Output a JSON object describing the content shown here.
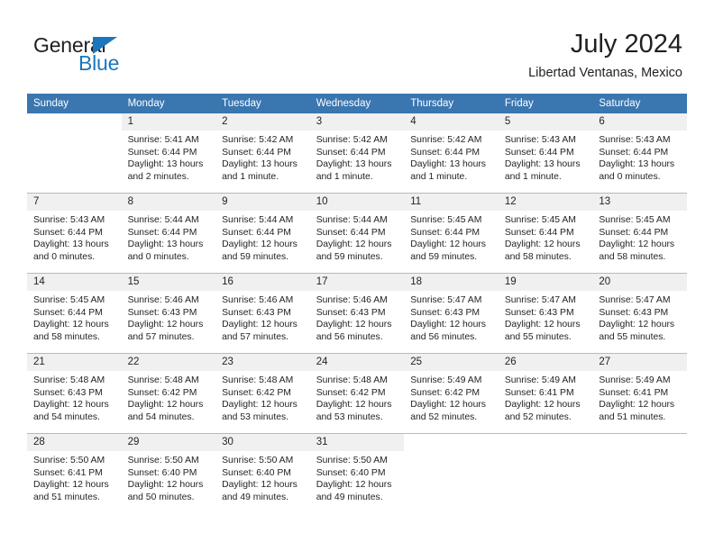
{
  "brand": {
    "name_part1": "General",
    "name_part2": "Blue",
    "triangle_color": "#1b76bc"
  },
  "header": {
    "title": "July 2024",
    "subtitle": "Libertad Ventanas, Mexico",
    "header_bg": "#3a76b0",
    "daynum_bg": "#f0f0f0"
  },
  "weekdays": [
    "Sunday",
    "Monday",
    "Tuesday",
    "Wednesday",
    "Thursday",
    "Friday",
    "Saturday"
  ],
  "weeks": [
    [
      {
        "day": "",
        "sunrise": "",
        "sunset": "",
        "daylight1": "",
        "daylight2": "",
        "empty": true
      },
      {
        "day": "1",
        "sunrise": "Sunrise: 5:41 AM",
        "sunset": "Sunset: 6:44 PM",
        "daylight1": "Daylight: 13 hours",
        "daylight2": "and 2 minutes."
      },
      {
        "day": "2",
        "sunrise": "Sunrise: 5:42 AM",
        "sunset": "Sunset: 6:44 PM",
        "daylight1": "Daylight: 13 hours",
        "daylight2": "and 1 minute."
      },
      {
        "day": "3",
        "sunrise": "Sunrise: 5:42 AM",
        "sunset": "Sunset: 6:44 PM",
        "daylight1": "Daylight: 13 hours",
        "daylight2": "and 1 minute."
      },
      {
        "day": "4",
        "sunrise": "Sunrise: 5:42 AM",
        "sunset": "Sunset: 6:44 PM",
        "daylight1": "Daylight: 13 hours",
        "daylight2": "and 1 minute."
      },
      {
        "day": "5",
        "sunrise": "Sunrise: 5:43 AM",
        "sunset": "Sunset: 6:44 PM",
        "daylight1": "Daylight: 13 hours",
        "daylight2": "and 1 minute."
      },
      {
        "day": "6",
        "sunrise": "Sunrise: 5:43 AM",
        "sunset": "Sunset: 6:44 PM",
        "daylight1": "Daylight: 13 hours",
        "daylight2": "and 0 minutes."
      }
    ],
    [
      {
        "day": "7",
        "sunrise": "Sunrise: 5:43 AM",
        "sunset": "Sunset: 6:44 PM",
        "daylight1": "Daylight: 13 hours",
        "daylight2": "and 0 minutes."
      },
      {
        "day": "8",
        "sunrise": "Sunrise: 5:44 AM",
        "sunset": "Sunset: 6:44 PM",
        "daylight1": "Daylight: 13 hours",
        "daylight2": "and 0 minutes."
      },
      {
        "day": "9",
        "sunrise": "Sunrise: 5:44 AM",
        "sunset": "Sunset: 6:44 PM",
        "daylight1": "Daylight: 12 hours",
        "daylight2": "and 59 minutes."
      },
      {
        "day": "10",
        "sunrise": "Sunrise: 5:44 AM",
        "sunset": "Sunset: 6:44 PM",
        "daylight1": "Daylight: 12 hours",
        "daylight2": "and 59 minutes."
      },
      {
        "day": "11",
        "sunrise": "Sunrise: 5:45 AM",
        "sunset": "Sunset: 6:44 PM",
        "daylight1": "Daylight: 12 hours",
        "daylight2": "and 59 minutes."
      },
      {
        "day": "12",
        "sunrise": "Sunrise: 5:45 AM",
        "sunset": "Sunset: 6:44 PM",
        "daylight1": "Daylight: 12 hours",
        "daylight2": "and 58 minutes."
      },
      {
        "day": "13",
        "sunrise": "Sunrise: 5:45 AM",
        "sunset": "Sunset: 6:44 PM",
        "daylight1": "Daylight: 12 hours",
        "daylight2": "and 58 minutes."
      }
    ],
    [
      {
        "day": "14",
        "sunrise": "Sunrise: 5:45 AM",
        "sunset": "Sunset: 6:44 PM",
        "daylight1": "Daylight: 12 hours",
        "daylight2": "and 58 minutes."
      },
      {
        "day": "15",
        "sunrise": "Sunrise: 5:46 AM",
        "sunset": "Sunset: 6:43 PM",
        "daylight1": "Daylight: 12 hours",
        "daylight2": "and 57 minutes."
      },
      {
        "day": "16",
        "sunrise": "Sunrise: 5:46 AM",
        "sunset": "Sunset: 6:43 PM",
        "daylight1": "Daylight: 12 hours",
        "daylight2": "and 57 minutes."
      },
      {
        "day": "17",
        "sunrise": "Sunrise: 5:46 AM",
        "sunset": "Sunset: 6:43 PM",
        "daylight1": "Daylight: 12 hours",
        "daylight2": "and 56 minutes."
      },
      {
        "day": "18",
        "sunrise": "Sunrise: 5:47 AM",
        "sunset": "Sunset: 6:43 PM",
        "daylight1": "Daylight: 12 hours",
        "daylight2": "and 56 minutes."
      },
      {
        "day": "19",
        "sunrise": "Sunrise: 5:47 AM",
        "sunset": "Sunset: 6:43 PM",
        "daylight1": "Daylight: 12 hours",
        "daylight2": "and 55 minutes."
      },
      {
        "day": "20",
        "sunrise": "Sunrise: 5:47 AM",
        "sunset": "Sunset: 6:43 PM",
        "daylight1": "Daylight: 12 hours",
        "daylight2": "and 55 minutes."
      }
    ],
    [
      {
        "day": "21",
        "sunrise": "Sunrise: 5:48 AM",
        "sunset": "Sunset: 6:43 PM",
        "daylight1": "Daylight: 12 hours",
        "daylight2": "and 54 minutes."
      },
      {
        "day": "22",
        "sunrise": "Sunrise: 5:48 AM",
        "sunset": "Sunset: 6:42 PM",
        "daylight1": "Daylight: 12 hours",
        "daylight2": "and 54 minutes."
      },
      {
        "day": "23",
        "sunrise": "Sunrise: 5:48 AM",
        "sunset": "Sunset: 6:42 PM",
        "daylight1": "Daylight: 12 hours",
        "daylight2": "and 53 minutes."
      },
      {
        "day": "24",
        "sunrise": "Sunrise: 5:48 AM",
        "sunset": "Sunset: 6:42 PM",
        "daylight1": "Daylight: 12 hours",
        "daylight2": "and 53 minutes."
      },
      {
        "day": "25",
        "sunrise": "Sunrise: 5:49 AM",
        "sunset": "Sunset: 6:42 PM",
        "daylight1": "Daylight: 12 hours",
        "daylight2": "and 52 minutes."
      },
      {
        "day": "26",
        "sunrise": "Sunrise: 5:49 AM",
        "sunset": "Sunset: 6:41 PM",
        "daylight1": "Daylight: 12 hours",
        "daylight2": "and 52 minutes."
      },
      {
        "day": "27",
        "sunrise": "Sunrise: 5:49 AM",
        "sunset": "Sunset: 6:41 PM",
        "daylight1": "Daylight: 12 hours",
        "daylight2": "and 51 minutes."
      }
    ],
    [
      {
        "day": "28",
        "sunrise": "Sunrise: 5:50 AM",
        "sunset": "Sunset: 6:41 PM",
        "daylight1": "Daylight: 12 hours",
        "daylight2": "and 51 minutes."
      },
      {
        "day": "29",
        "sunrise": "Sunrise: 5:50 AM",
        "sunset": "Sunset: 6:40 PM",
        "daylight1": "Daylight: 12 hours",
        "daylight2": "and 50 minutes."
      },
      {
        "day": "30",
        "sunrise": "Sunrise: 5:50 AM",
        "sunset": "Sunset: 6:40 PM",
        "daylight1": "Daylight: 12 hours",
        "daylight2": "and 49 minutes."
      },
      {
        "day": "31",
        "sunrise": "Sunrise: 5:50 AM",
        "sunset": "Sunset: 6:40 PM",
        "daylight1": "Daylight: 12 hours",
        "daylight2": "and 49 minutes."
      },
      {
        "day": "",
        "sunrise": "",
        "sunset": "",
        "daylight1": "",
        "daylight2": "",
        "empty": true
      },
      {
        "day": "",
        "sunrise": "",
        "sunset": "",
        "daylight1": "",
        "daylight2": "",
        "empty": true
      },
      {
        "day": "",
        "sunrise": "",
        "sunset": "",
        "daylight1": "",
        "daylight2": "",
        "empty": true
      }
    ]
  ]
}
